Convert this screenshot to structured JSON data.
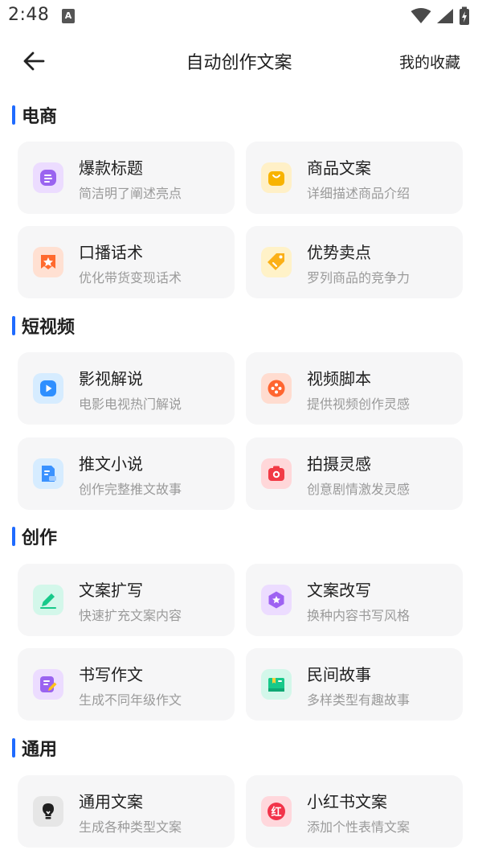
{
  "status": {
    "time": "2:48",
    "indicator": "A"
  },
  "header": {
    "title": "自动创作文案",
    "favorites": "我的收藏"
  },
  "sections": [
    {
      "title": "电商",
      "cards": [
        {
          "title": "爆款标题",
          "sub": "简洁明了阐述亮点"
        },
        {
          "title": "商品文案",
          "sub": "详细描述商品介绍"
        },
        {
          "title": "口播话术",
          "sub": "优化带货变现话术"
        },
        {
          "title": "优势卖点",
          "sub": "罗列商品的竞争力"
        }
      ]
    },
    {
      "title": "短视频",
      "cards": [
        {
          "title": "影视解说",
          "sub": "电影电视热门解说"
        },
        {
          "title": "视频脚本",
          "sub": "提供视频创作灵感"
        },
        {
          "title": "推文小说",
          "sub": "创作完整推文故事"
        },
        {
          "title": "拍摄灵感",
          "sub": "创意剧情激发灵感"
        }
      ]
    },
    {
      "title": "创作",
      "cards": [
        {
          "title": "文案扩写",
          "sub": "快速扩充文案内容"
        },
        {
          "title": "文案改写",
          "sub": "换种内容书写风格"
        },
        {
          "title": "书写作文",
          "sub": "生成不同年级作文"
        },
        {
          "title": "民间故事",
          "sub": "多样类型有趣故事"
        }
      ]
    },
    {
      "title": "通用",
      "cards": [
        {
          "title": "通用文案",
          "sub": "生成各种类型文案"
        },
        {
          "title": "小红书文案",
          "sub": "添加个性表情文案"
        }
      ]
    }
  ],
  "icons": {
    "list": "list-doc-icon",
    "bag": "shopping-bag-icon",
    "star_badge": "star-badge-icon",
    "tag": "price-tag-icon",
    "play": "play-icon",
    "film": "film-reel-icon",
    "doc": "document-icon",
    "camera": "camera-icon",
    "pen": "pen-icon",
    "hex_star": "hexagon-star-icon",
    "edit": "edit-note-icon",
    "book": "book-icon",
    "bulb": "lightbulb-icon",
    "red": "xiaohongshu-icon"
  },
  "red_icon_text": "红",
  "colors": {
    "accent": "#1f6bff",
    "card_bg": "#f6f6f7",
    "subtitle": "#9a9a9a"
  }
}
